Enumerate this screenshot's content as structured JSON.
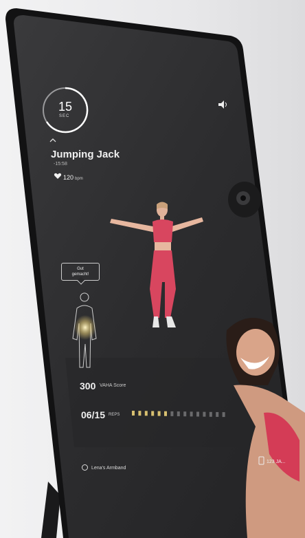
{
  "workout": {
    "timer_value": "15",
    "timer_unit": "SEC",
    "exercise_name": "Jumping Jack",
    "exercise_time": "-15:58",
    "heart_rate": "120",
    "heart_rate_unit": "bpm"
  },
  "feedback": {
    "line1": "Gut",
    "line2": "gemacht!"
  },
  "stats": {
    "score_value": "300",
    "score_label": "VAHA Score",
    "reps_value": "06/15",
    "reps_label": "REPS",
    "reps_done": 6,
    "reps_total": 15
  },
  "device": {
    "band_label": "Lena's Armband",
    "right_label": "123 JA..."
  },
  "icons": [
    "volume-icon",
    "heart-icon",
    "timer-ring-icon",
    "chevron-up-icon",
    "body-outline-icon",
    "wristband-icon",
    "phone-icon",
    "camera-lens-icon"
  ],
  "colors": {
    "screen": "#2b2b2d",
    "frame": "#111112",
    "accent_gold": "#d8c070",
    "athlete_pink": "#d8465f"
  }
}
